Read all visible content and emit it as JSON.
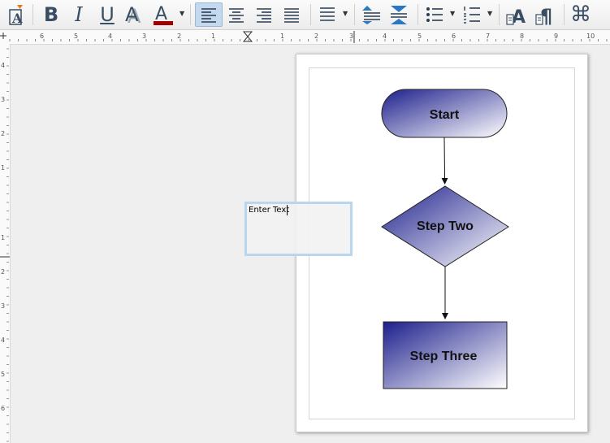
{
  "toolbar": {
    "items": [
      {
        "name": "text-style-icon"
      },
      {
        "name": "bold-icon",
        "glyph": "B"
      },
      {
        "name": "italic-icon",
        "glyph": "I"
      },
      {
        "name": "underline-icon",
        "glyph": "U"
      },
      {
        "name": "shadow-text-icon",
        "glyph": "A"
      },
      {
        "name": "font-color-icon",
        "glyph": "A",
        "color": "#a40000"
      },
      {
        "name": "align-left-icon",
        "active": true
      },
      {
        "name": "align-center-icon"
      },
      {
        "name": "align-right-icon"
      },
      {
        "name": "justify-icon"
      },
      {
        "name": "line-spacing-icon"
      },
      {
        "name": "paragraph-spacing-icon"
      },
      {
        "name": "bullets-icon"
      },
      {
        "name": "numbering-icon"
      },
      {
        "name": "character-icon"
      },
      {
        "name": "paragraph-icon"
      },
      {
        "name": "command-icon",
        "glyph": "⌘"
      }
    ]
  },
  "ruler": {
    "horizontal": [
      "6",
      "5",
      "4",
      "3",
      "2",
      "1",
      "1",
      "2",
      "3",
      "4",
      "5",
      "6",
      "7",
      "8",
      "9",
      "10"
    ],
    "vertical": [
      "4",
      "3",
      "2",
      "1",
      "1",
      "2",
      "3",
      "4",
      "5",
      "6"
    ]
  },
  "textbox": {
    "text": "Enter Text"
  },
  "flowchart": {
    "start_label": "Start",
    "step_two_label": "Step Two",
    "step_three_label": "Step Three",
    "gradient_start": "#1d1f8c",
    "gradient_end": "#ffffff"
  }
}
